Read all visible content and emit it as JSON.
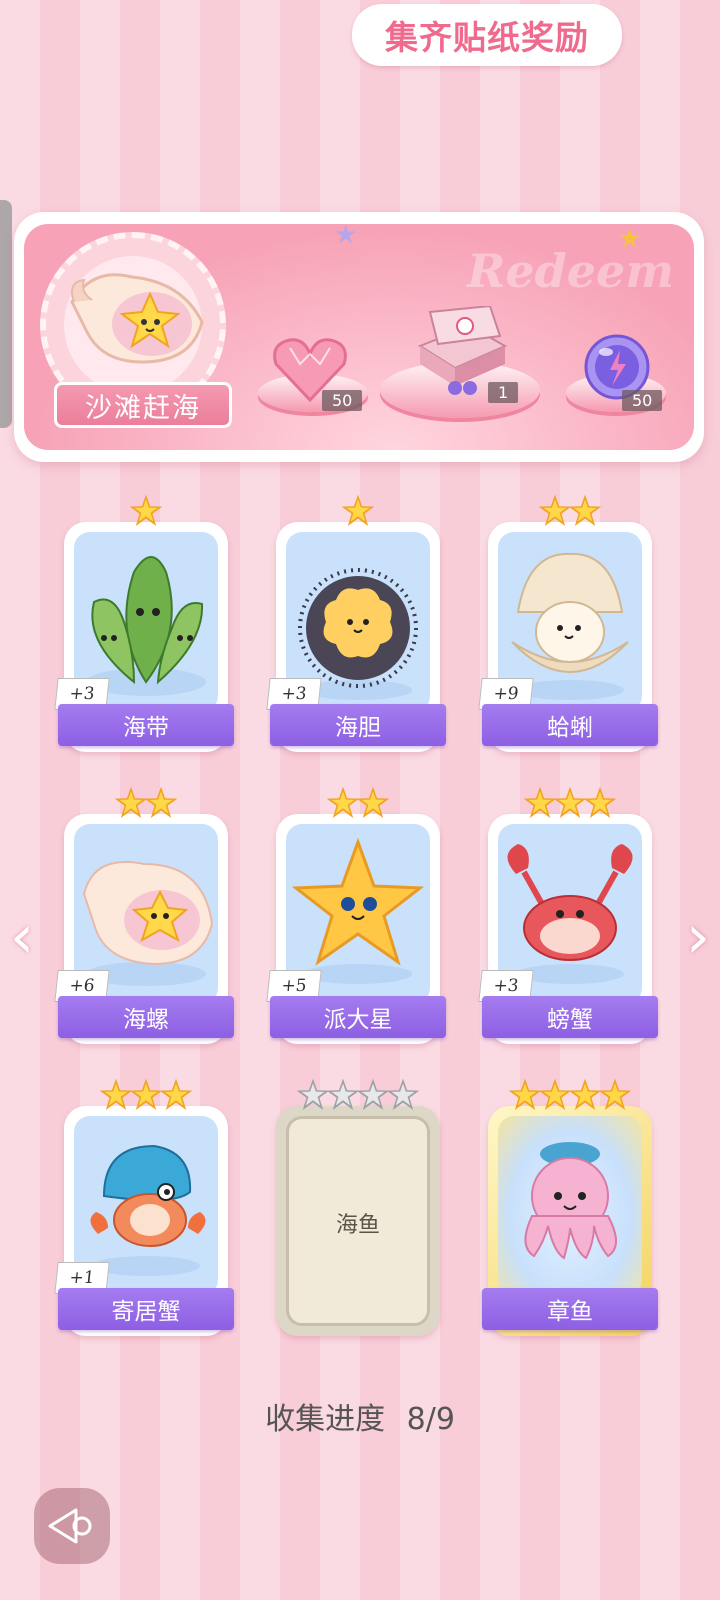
{
  "banner": {
    "title": "集齐贴纸奖励",
    "watermark": "Redeem",
    "theme_name": "沙滩赶海",
    "rewards": [
      {
        "icon": "pink-heart-gem-icon",
        "count": "50"
      },
      {
        "icon": "gift-box-icon",
        "count": "1"
      },
      {
        "icon": "energy-orb-icon",
        "count": "50"
      }
    ]
  },
  "cards": [
    {
      "name": "海带",
      "stars": 1,
      "qty": "+3",
      "collected": true
    },
    {
      "name": "海胆",
      "stars": 1,
      "qty": "+3",
      "collected": true
    },
    {
      "name": "蛤蜊",
      "stars": 2,
      "qty": "+9",
      "collected": true
    },
    {
      "name": "海螺",
      "stars": 2,
      "qty": "+6",
      "collected": true
    },
    {
      "name": "派大星",
      "stars": 2,
      "qty": "+5",
      "collected": true
    },
    {
      "name": "螃蟹",
      "stars": 3,
      "qty": "+3",
      "collected": true
    },
    {
      "name": "寄居蟹",
      "stars": 3,
      "qty": "+1",
      "collected": true
    },
    {
      "name": "海鱼",
      "stars": 4,
      "qty": "",
      "collected": false
    },
    {
      "name": "章鱼",
      "stars": 4,
      "qty": "",
      "collected": true
    }
  ],
  "progress": {
    "label": "收集进度",
    "value": "8/9"
  },
  "colors": {
    "label_purple": "#8d5fe3",
    "title_pink": "#ef6a8c",
    "star_gold": "#ffd84a"
  }
}
